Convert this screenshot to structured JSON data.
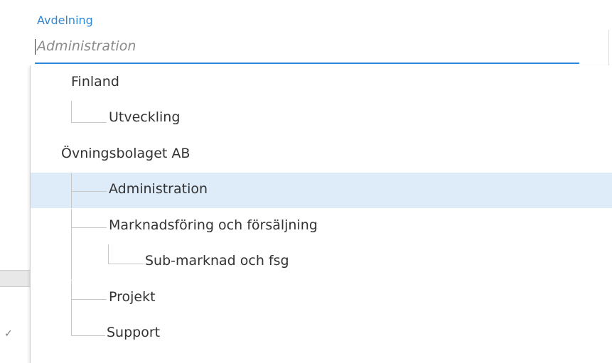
{
  "field": {
    "label": "Avdelning",
    "placeholder": "Administration"
  },
  "tree": {
    "items": [
      {
        "label": "Finland",
        "level": 0
      },
      {
        "label": "Utveckling",
        "level": 1
      },
      {
        "label": "Övningsbolaget AB",
        "level": 0
      },
      {
        "label": "Administration",
        "level": 1,
        "selected": true
      },
      {
        "label": "Marknadsföring och försäljning",
        "level": 1
      },
      {
        "label": "Sub-marknad och fsg",
        "level": 2
      },
      {
        "label": "Projekt",
        "level": 1
      },
      {
        "label": "Support",
        "level": 1
      }
    ]
  },
  "colors": {
    "accent": "#2f86d6",
    "selected_bg": "#deecf9",
    "placeholder": "#8a8a8a"
  },
  "background": {
    "check_glyph": "✓"
  }
}
